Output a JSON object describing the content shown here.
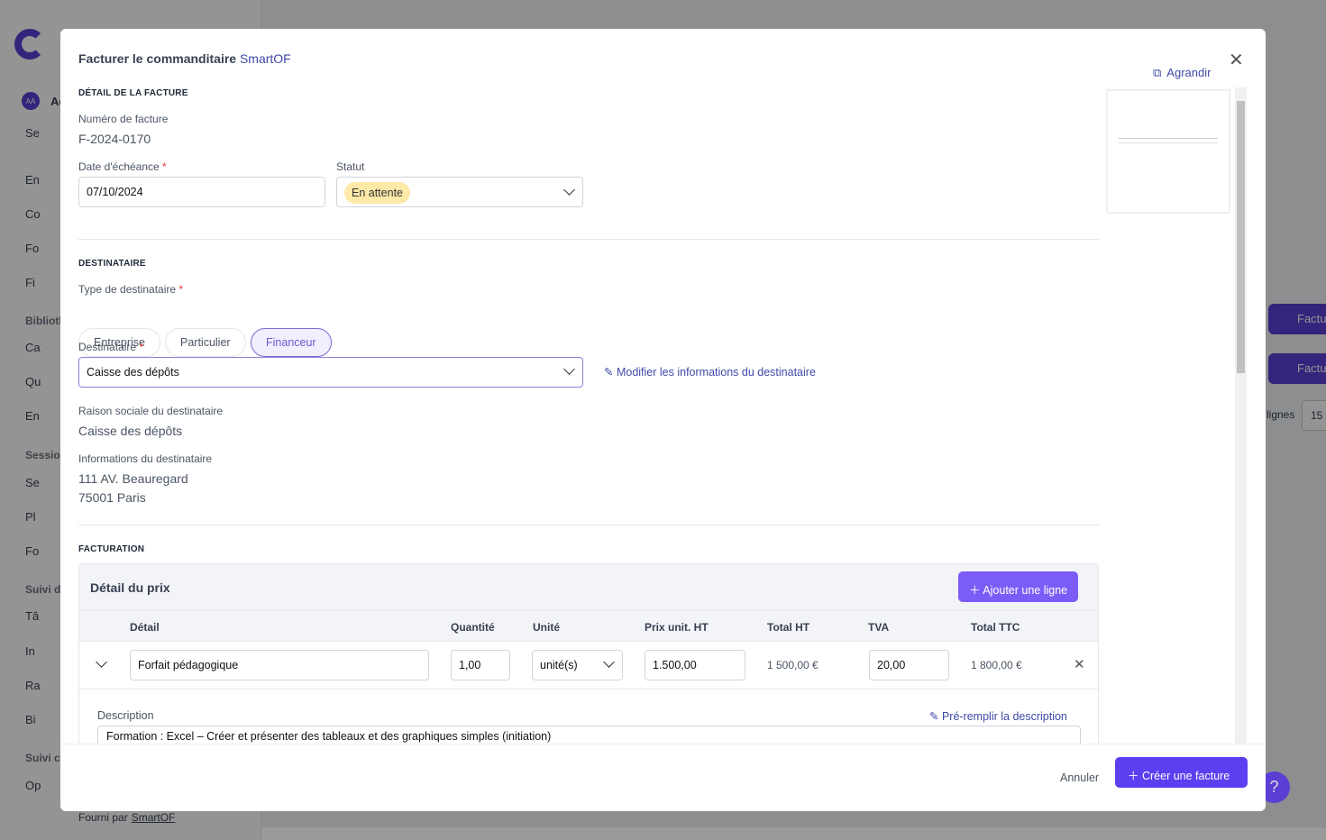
{
  "background": {
    "sidebar": {
      "avatar": "AA",
      "items": [
        "Ac",
        "Se",
        "En",
        "Co",
        "Fo",
        "Fi",
        "Ca",
        "Qu",
        "En",
        "Se",
        "Pl",
        "Fo",
        "Tâ",
        "In",
        "Ra",
        "Bi",
        "Op"
      ],
      "groups": [
        "Biblioth",
        "Sessio",
        "Suivi d",
        "Suivi c"
      ],
      "footer_prefix": "Fourni par",
      "footer_link": "SmartOF"
    },
    "right_buttons": [
      "Factu",
      "Factu"
    ],
    "lignes_label": "lignes",
    "lignes_value": "15"
  },
  "modal": {
    "title": "Facturer le commanditaire",
    "title_org": "SmartOF",
    "expand_label": "Agrandir",
    "invoice": {
      "section": "DÉTAIL DE LA FACTURE",
      "number_label": "Numéro de facture",
      "number": "F-2024-0170",
      "due_label": "Date d'échéance",
      "due": "07/10/2024",
      "status_label": "Statut",
      "status": "En attente",
      "status_color": "#fde9a8"
    },
    "recipient": {
      "section": "DESTINATAIRE",
      "type_label": "Type de destinataire",
      "types": [
        "Entreprise",
        "Particulier",
        "Financeur"
      ],
      "selected_type": "Financeur",
      "dest_label": "Destinataire",
      "dest": "Caisse des dépôts",
      "edit_link": "Modifier les informations du destinataire",
      "raison_label": "Raison sociale du destinataire",
      "raison": "Caisse des dépôts",
      "info_label": "Informations du destinataire",
      "address1": "111 AV. Beauregard",
      "address2": "75001 Paris"
    },
    "billing": {
      "section": "FACTURATION",
      "box_title": "Détail du prix",
      "add_line": "Ajouter une ligne",
      "columns": [
        "Détail",
        "Quantité",
        "Unité",
        "Prix unit. HT",
        "Total HT",
        "TVA",
        "Total TTC"
      ],
      "row": {
        "detail": "Forfait pédagogique",
        "qty": "1,00",
        "unit": "unité(s)",
        "price": "1.500,00",
        "total_ht": "1 500,00 €",
        "tva": "20,00",
        "total_ttc": "1 800,00 €"
      },
      "desc_label": "Description",
      "prefill": "Pré-remplir la description",
      "desc": "Formation : Excel – Créer et présenter des tableaux et des graphiques simples (initiation)"
    },
    "cancel": "Annuler",
    "create": "Créer une facture"
  },
  "colors": {
    "accent": "#5b3ff0",
    "link": "#3f4aa8"
  }
}
